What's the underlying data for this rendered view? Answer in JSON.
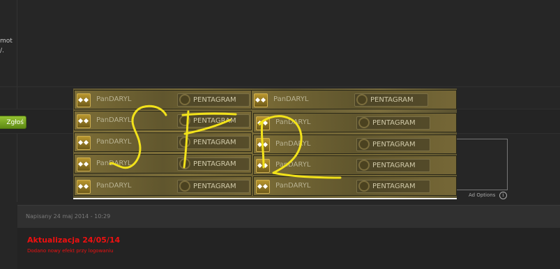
{
  "post": {
    "text_fragment_1": "mot",
    "text_fragment_2": "/."
  },
  "actions": {
    "report_label": "Zgłoś"
  },
  "meta": {
    "posted": "Napisany 24 maj 2014 - 10:29"
  },
  "update": {
    "title": "Aktualizacja 24/05/14",
    "text": "Dodano nowy efekt przy logowaniu"
  },
  "ad": {
    "options_label": "Ad Options",
    "info_glyph": "i"
  },
  "banner": {
    "rows": [
      {
        "left": {
          "player": "PanDARYL",
          "guild": "PENTAGRAM"
        },
        "right": {
          "player": "PanDARYL",
          "guild": "PENTAGRAM"
        }
      },
      {
        "left": {
          "player": "PanDARYL",
          "guild": "PENTAGRAM"
        },
        "right": {
          "player": "PanDARYL",
          "guild": "PENTAGRAM"
        }
      },
      {
        "left": {
          "player": "PanDARYL",
          "guild": "PENTAGRAM"
        },
        "right": {
          "player": "PanDARYL",
          "guild": "PENTAGRAM"
        }
      },
      {
        "left": {
          "player": "PanDARYL",
          "guild": "PENTAGRAM"
        },
        "right": {
          "player": "PanDARYL",
          "guild": "PENTAGRAM"
        }
      },
      {
        "left": {
          "player": "PanDARYL",
          "guild": "PENTAGRAM"
        },
        "right": {
          "player": "PanDARYL",
          "guild": "PENTAGRAM"
        }
      }
    ],
    "annotation_color": "#f2e21a"
  }
}
